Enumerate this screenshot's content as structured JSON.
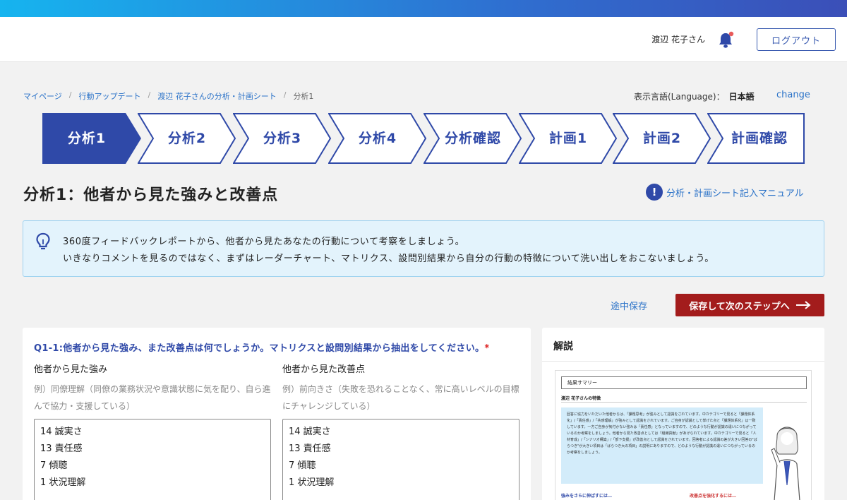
{
  "header": {
    "user_name": "渡辺 花子さん",
    "logout_label": "ログアウト"
  },
  "breadcrumb": {
    "items": [
      "マイページ",
      "行動アップデート",
      "渡辺 花子さんの分析・計画シート"
    ],
    "current": "分析1"
  },
  "language": {
    "label": "表示言語(Language)：",
    "value": "日本語",
    "change_label": "change"
  },
  "steps": [
    {
      "label": "分析1",
      "active": true
    },
    {
      "label": "分析2",
      "active": false
    },
    {
      "label": "分析3",
      "active": false
    },
    {
      "label": "分析4",
      "active": false
    },
    {
      "label": "分析確認",
      "active": false
    },
    {
      "label": "計画1",
      "active": false
    },
    {
      "label": "計画2",
      "active": false
    },
    {
      "label": "計画確認",
      "active": false
    }
  ],
  "page": {
    "title": "分析1：他者から見た強みと改善点",
    "manual_link": "分析・計画シート記入マニュアル"
  },
  "hint": {
    "line1": "360度フィードバックレポートから、他者から見たあなたの行動について考察をしましょう。",
    "line2": "いきなりコメントを見るのではなく、まずはレーダーチャート、マトリクス、設問別結果から自分の行動の特徴について洗い出しをおこないましょう。"
  },
  "actions": {
    "save_draft": "途中保存",
    "save_next": "保存して次のステップへ"
  },
  "question": {
    "text": "Q1-1:他者から見た強み、また改善点は何でしょうか。マトリクスと設問別結果から抽出をしてください。",
    "required_mark": "*",
    "strengths": {
      "label": "他者から見た強み",
      "example": "例）同僚理解（同僚の業務状況や意識状態に気を配り、自ら進んで協力・支援している）",
      "value": "14 誠実さ\n13 責任感\n7 傾聴\n1 状況理解"
    },
    "improvements": {
      "label": "他者から見た改善点",
      "example": "例）前向きさ（失敗を恐れることなく、常に高いレベルの目標にチャレンジしている）",
      "value": "14 誠実さ\n13 責任感\n7 傾聴\n1 状況理解"
    }
  },
  "explanation": {
    "title": "解説",
    "thumb_box": "結果サマリー",
    "thumb_subtitle": "渡辺 花子さんの特徴",
    "thumb_summary": "回答に協力をいただいた他者からは、「課題思考」が強みとして認識をされています。中カテゴリーで見ると「課題体系化」/「責任感」/「共感理解」が強みとして認識をされています。ご自身が認識として挙げた点と「課題体系化」は一致しています。一方ご自身が気付かない強みは「責任感」となっていますので、どのような行動が認識の違いにつながっているのか考察をしましょう。他者から見た改善点としては「組織貢献」があげられています。中カテゴリーで見ると「人材育成」/「シナリオ構築」/「部下支援」が改善点として認識をされています。回答者による認識の差が大きい回答の\"ばらつき\"が大きい項目は「ばらつき大の項目」の説明にありますので、どのような行動が認識の違いにつながっているのか考察をしましょう。",
    "thumb_left": "強みをさらに伸ばすには…",
    "thumb_right": "改善点を強化するには…"
  },
  "colors": {
    "brand_blue": "#2f49a8",
    "link_blue": "#2a72c8",
    "primary_red": "#a31c1c",
    "hint_bg": "#e3f3fc"
  }
}
